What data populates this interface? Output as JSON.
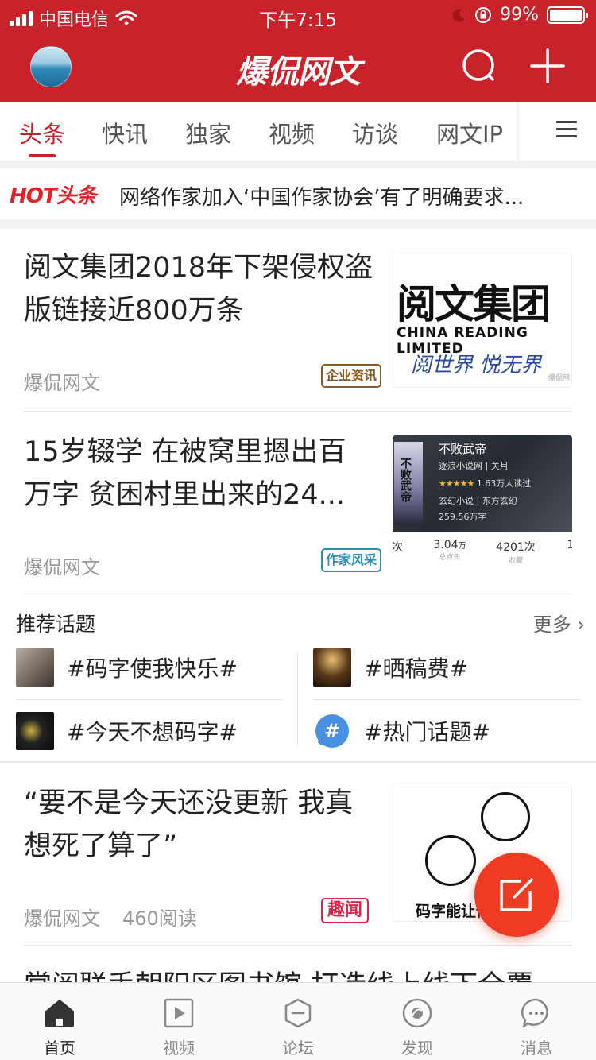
{
  "status_bar": {
    "carrier": "中国电信",
    "time": "下午7:15",
    "battery_percent": "99%",
    "battery_level": 0.99
  },
  "header": {
    "logo_text": "爆侃网文",
    "search_icon": "search-icon",
    "add_icon": "plus-icon"
  },
  "tabs": [
    "头条",
    "快讯",
    "独家",
    "视频",
    "访谈",
    "网文IP"
  ],
  "active_tab": "头条",
  "hot": {
    "label": "HOT头条",
    "headline": "网络作家加入‘中国作家协会’有了明确要求..."
  },
  "articles": [
    {
      "title": "阅文集团2018年下架侵权盗版链接近800万条",
      "source": "爆侃网文",
      "tag": "企业资讯",
      "tag_color": "#8a5a1e",
      "thumb": {
        "big": "阅文集团",
        "en": "CHINA READING LIMITED",
        "slogan": "阅世界 悦无界",
        "watermark": "爆侃网"
      }
    },
    {
      "title": "15岁辍学 在被窝里摁出百万字 贫困村里出来的24...",
      "source": "爆侃网文",
      "tag": "作家风采",
      "tag_color": "#2a8fb3",
      "thumb": {
        "book_title": "不败武帝",
        "cover_text": "不败武帝",
        "line1": "逐浪小说网 | 关月",
        "rating": "★★★★★",
        "rating_text": "1.63万人读过",
        "line3": "玄幻小说 | 东方玄幻",
        "line4": "259.56万字",
        "stats": [
          {
            "value": "次",
            "label": "",
            "unit": ""
          },
          {
            "value": "3.04",
            "unit": "万",
            "label": "总点击"
          },
          {
            "value": "4201次",
            "unit": "",
            "label": "收藏"
          },
          {
            "value": "1",
            "unit": "",
            "label": ""
          }
        ]
      }
    },
    {
      "title": "“要不是今天还没更新 我真想死了算了”",
      "source": "爆侃网文",
      "reads": "460阅读",
      "tag": "趣闻",
      "tag_color": "#d8264b",
      "thumb": {
        "caption": "码字能让你"
      }
    }
  ],
  "topics": {
    "header": "推荐话题",
    "more": "更多",
    "items": [
      {
        "text": "#码字使我快乐#",
        "img_color": "#8a7a70"
      },
      {
        "text": "#晒稿费#",
        "img_color": "#3a2a1a"
      },
      {
        "text": "#今天不想码字#",
        "img_color": "#1a1a12"
      },
      {
        "text": "#热门话题#",
        "icon": "hashtag-icon",
        "img_color": "#4a90e2"
      }
    ]
  },
  "peek_title": "掌阅联手朝阳区图书馆 打造线上线下全覆",
  "bottom_nav": [
    {
      "label": "首页",
      "icon": "home-icon",
      "active": true
    },
    {
      "label": "视频",
      "icon": "video-icon",
      "active": false
    },
    {
      "label": "论坛",
      "icon": "forum-icon",
      "active": false
    },
    {
      "label": "发现",
      "icon": "discover-icon",
      "active": false
    },
    {
      "label": "消息",
      "icon": "message-icon",
      "active": false
    }
  ],
  "colors": {
    "brand_red": "#c8232a",
    "fab": "#ef3b24",
    "hot_label": "#e3232a"
  }
}
